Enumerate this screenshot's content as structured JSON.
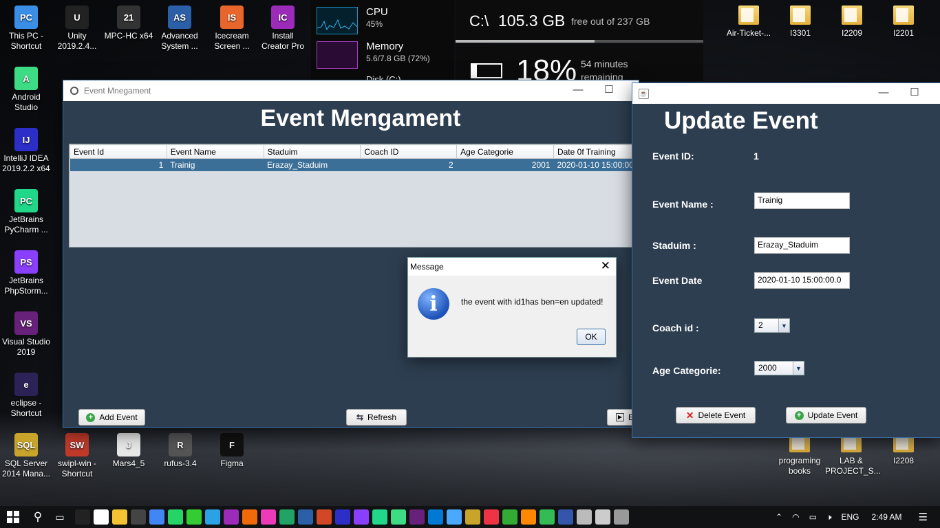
{
  "desktop": {
    "left_icons": [
      {
        "label": "This PC -\nShortcut",
        "color": "#3a8ee6",
        "glyph": "PC"
      },
      {
        "label": "Unity\n2019.2.4...",
        "color": "#222",
        "glyph": "U"
      },
      {
        "label": "MPC-HC x64",
        "color": "#333",
        "glyph": "21"
      },
      {
        "label": "Advanced\nSystem ...",
        "color": "#2b5fa8",
        "glyph": "AS"
      },
      {
        "label": "Icecream\nScreen ...",
        "color": "#e8662b",
        "glyph": "IS"
      },
      {
        "label": "Install\nCreator Pro",
        "color": "#9b2bb8",
        "glyph": "IC"
      },
      {
        "label": "Android\nStudio",
        "color": "#3ddc84",
        "glyph": "A"
      },
      {
        "label": "IntelliJ IDEA\n2019.2.2 x64",
        "color": "#2d2dc8",
        "glyph": "IJ"
      },
      {
        "label": "JetBrains\nPyCharm ...",
        "color": "#21d789",
        "glyph": "PC"
      },
      {
        "label": "JetBrains\nPhpStorm...",
        "color": "#8a3ffc",
        "glyph": "PS"
      },
      {
        "label": "Visual Studio\n2019",
        "color": "#68217a",
        "glyph": "VS"
      },
      {
        "label": "eclipse -\nShortcut",
        "color": "#2c2255",
        "glyph": "e"
      },
      {
        "label": "SQL Server\n2014 Mana...",
        "color": "#c8a42a",
        "glyph": "SQL"
      },
      {
        "label": "swipl-win -\nShortcut",
        "color": "#c0392b",
        "glyph": "SW"
      },
      {
        "label": "Mars4_5",
        "color": "#e8e8e8",
        "glyph": "J"
      },
      {
        "label": "rufus-3.4",
        "color": "#555",
        "glyph": "R"
      },
      {
        "label": "Figma",
        "color": "#111",
        "glyph": "F"
      }
    ],
    "right_folders": [
      "Air-Ticket-...",
      "I3301",
      "I2209",
      "I2201",
      "programing\nbooks",
      "LAB &\nPROJECT_S...",
      "I2208"
    ]
  },
  "widgets": {
    "cpu_label": "CPU",
    "cpu_value": "45%",
    "mem_label": "Memory",
    "mem_value": "5.6/7.8 GB (72%)",
    "disk_label": "Disk (C:)",
    "drive": "C:\\",
    "free": "105.3 GB",
    "free_text": "free out of 237 GB",
    "battery": "18%",
    "battery_time": "54 minutes\nremaining"
  },
  "main_window": {
    "title": "Event Mnegament",
    "heading": "Event Mengament",
    "columns": [
      "Event Id",
      "Event Name",
      "Staduim",
      "Coach ID",
      "Age Categorie",
      "Date 0f Training"
    ],
    "row": [
      "1",
      "Trainig",
      "Erazay_Staduim",
      "2",
      "2001",
      "2020-01-10 15:00:00.0"
    ],
    "add_label": "Add Event",
    "refresh_label": "Refresh",
    "exit_label": "E"
  },
  "dialog": {
    "title": "Message",
    "text": "the event with id1has ben=en updated!",
    "ok": "OK"
  },
  "update_window": {
    "heading": "Update Event",
    "id_label": "Event ID:",
    "id_value": "1",
    "name_label": "Event Name :",
    "name_value": "Trainig",
    "stadium_label": "Staduim :",
    "stadium_value": "Erazay_Staduim",
    "date_label": "Event Date",
    "date_value": "2020-01-10 15:00:00.0",
    "coach_label": "Coach id :",
    "coach_value": "2",
    "age_label": "Age Categorie:",
    "age_value": "2000",
    "delete_label": "Delete Event",
    "update_label": "Update Event"
  },
  "taskbar": {
    "lang": "ENG",
    "time": "2:49 AM"
  }
}
